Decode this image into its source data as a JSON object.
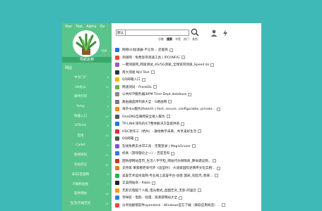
{
  "topnav": [
    "Star",
    "Test",
    "Alpha",
    "Ov"
  ],
  "sidebar": {
    "badge": "TOP",
    "banner": "导航名称",
    "nav_header": "网站",
    "items": [
      {
        "label": "中文门户",
        "count": "8"
      },
      {
        "label": "OA办公",
        "count": "15"
      },
      {
        "label": "邮件打印",
        "count": "7"
      },
      {
        "label": "Temp",
        "count": "9"
      },
      {
        "label": "快捷入口",
        "count": "12"
      },
      {
        "label": "OfTools",
        "count": "6"
      },
      {
        "label": "常用",
        "count": "14"
      },
      {
        "label": "Cadet",
        "count": "3"
      },
      {
        "label": "新闻资讯",
        "count": "11"
      },
      {
        "label": "科技前沿",
        "count": "10"
      },
      {
        "label": "知识/百度网",
        "count": "9"
      },
      {
        "label": "IT解析站盘",
        "count": "7"
      },
      {
        "label": "软件网站",
        "count": "18"
      },
      {
        "label": "生活/在线空间",
        "count": "12"
      }
    ]
  },
  "search": {
    "engine": "默认",
    "placeholder": "",
    "button_icon": "search-icon"
  },
  "tabs": [
    "谷歌",
    "搜索",
    "书签",
    "热门",
    "其他"
  ],
  "active_tab": "搜索",
  "links": [
    {
      "title": "网络UU加速器-不让你... 还能快",
      "color": "#2a6fd6"
    },
    {
      "title": "测速网 - 免费宽带测速工具 | IPCONFIG",
      "color": "#e04b2e"
    },
    {
      "title": "一键测速网_网速测试_4G/5G测速_全球宽带测速_Speed.do",
      "color": "#9b59b6"
    },
    {
      "title": "南大测速 NJU Test",
      "color": "#333"
    },
    {
      "title": "QQ邮箱入口",
      "color": "#f0b400"
    },
    {
      "title": "网速测试 - PrankDL",
      "color": "#6bb04a"
    },
    {
      "title": "公共NTP服务器|BPM Time Dept database",
      "color": "#888"
    },
    {
      "title": "路由器品牌列表大全 - G路由网",
      "color": "#7a7a7a"
    },
    {
      "title": "海外dns服务|Rebirth | Fast, secure, configurable, private...",
      "color": "#f08a24"
    },
    {
      "title": "OneDNS互联网安全接入服务",
      "color": "#555"
    },
    {
      "title": "TP-LINK-领先的ICT整体解决方案提供商",
      "color": "#1f7ad1"
    },
    {
      "title": "HDC新华三（杭州）- 融绘数字未来，共享美好生活",
      "color": "#d32f2f"
    },
    {
      "title": "QQ邮箱",
      "color": "#555"
    },
    {
      "title": "在线免费去水印工具 - 无需登录 | MagicEraser",
      "color": "#7e57c2"
    },
    {
      "title": "修真（游戏理论之一）- 百度百科",
      "color": "#3e74d6"
    },
    {
      "title": "国防部网站首页_生活八字学检_网站代办保障商_算命建议网...",
      "color": "#c23b22"
    },
    {
      "title": "支持第 黄紫檀老商代开《造型时》-大道家园陈述网传文化实相...",
      "color": "#e67e22"
    },
    {
      "title": "美容艺术运纹美网-专业线上美容平台-加密 国表_轮起杰_翡翠...",
      "color": "#27ae60"
    },
    {
      "title": "又美网站商 - Pablo",
      "color": "#222"
    },
    {
      "title": "无影云电脑个人版_电光模式_直面无穷_无影-阿里云",
      "color": "#f39c12"
    },
    {
      "title": "领导航 - 电影、动漫、资源游网站大全",
      "color": "#2d7be5"
    },
    {
      "title": "分享贴解锁软件opendesk - Windows官方下载（微软应用商店）...",
      "color": "#e74c3c"
    }
  ]
}
